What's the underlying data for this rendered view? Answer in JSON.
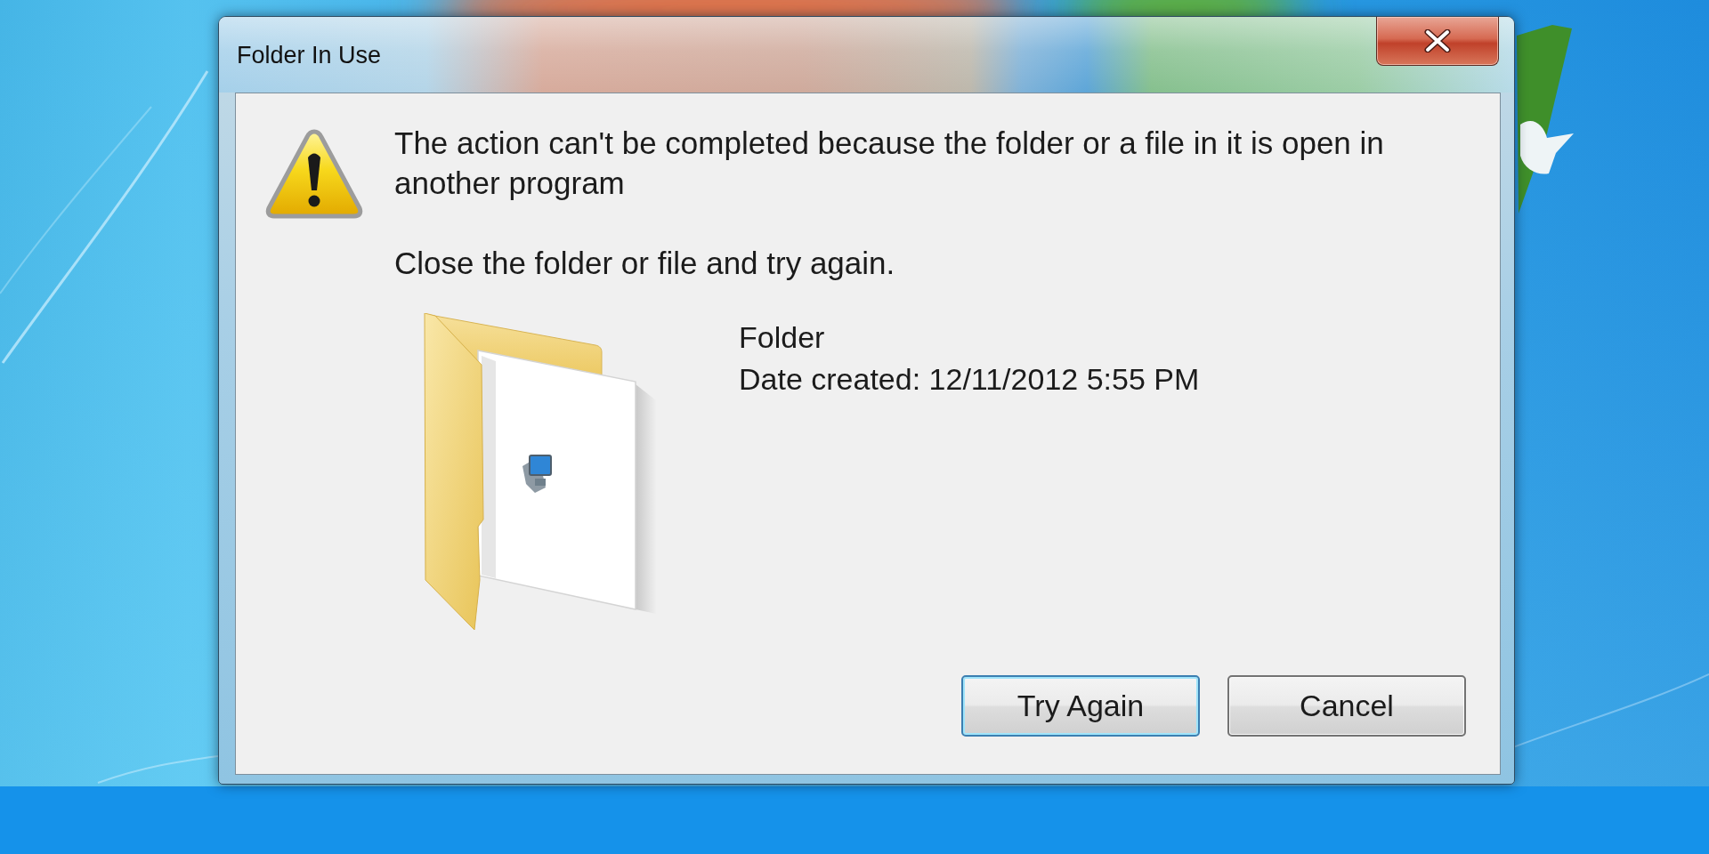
{
  "window": {
    "title": "Folder In Use"
  },
  "message": {
    "text": "The action can't be completed because the folder or a file in it is open in another program",
    "hint": "Close the folder or file and try again."
  },
  "item": {
    "name": "Folder",
    "date_created": "Date created: 12/11/2012 5:55 PM"
  },
  "buttons": [
    {
      "label": "Try Again",
      "default": true
    },
    {
      "label": "Cancel",
      "default": false
    }
  ]
}
